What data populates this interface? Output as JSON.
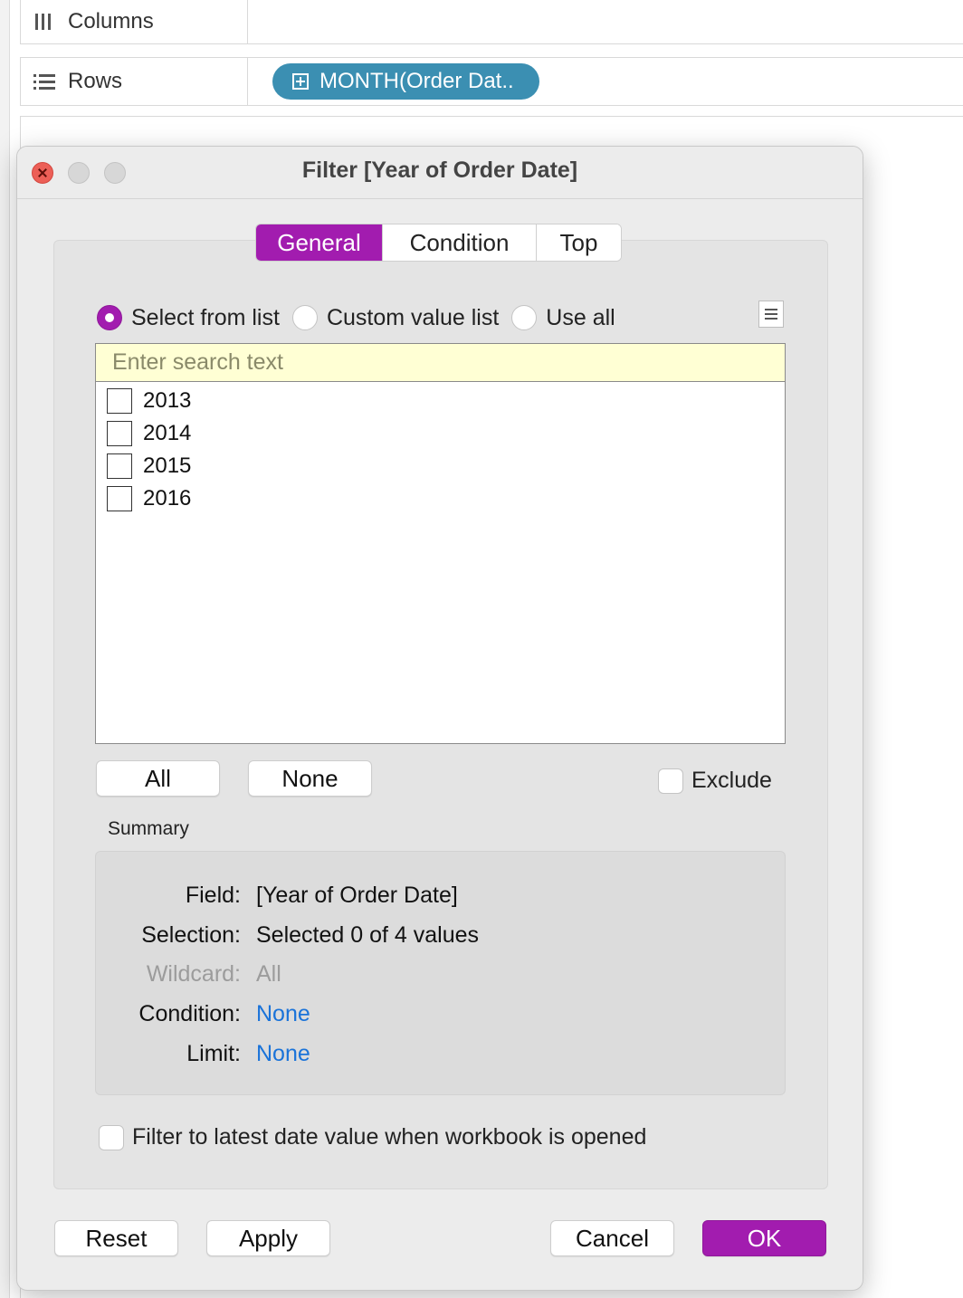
{
  "shelves": {
    "columns_label": "Columns",
    "rows_label": "Rows",
    "rows_pill": "MONTH(Order Dat.."
  },
  "dialog": {
    "title": "Filter [Year of Order Date]",
    "tabs": [
      "General",
      "Condition",
      "Top"
    ],
    "active_tab": "General",
    "mode_options": [
      "Select from list",
      "Custom value list",
      "Use all"
    ],
    "selected_mode": "Select from list",
    "search_placeholder": "Enter search text",
    "values": [
      "2013",
      "2014",
      "2015",
      "2016"
    ],
    "all_button": "All",
    "none_button": "None",
    "exclude_label": "Exclude",
    "exclude_checked": false,
    "summary_title": "Summary",
    "summary": {
      "field_key": "Field:",
      "field_val": "[Year of Order Date]",
      "selection_key": "Selection:",
      "selection_val": "Selected 0 of 4 values",
      "wildcard_key": "Wildcard:",
      "wildcard_val": "All",
      "condition_key": "Condition:",
      "condition_val": "None",
      "limit_key": "Limit:",
      "limit_val": "None"
    },
    "latest_date_label": "Filter to latest date value when workbook is opened",
    "latest_date_checked": false,
    "buttons": {
      "reset": "Reset",
      "apply": "Apply",
      "cancel": "Cancel",
      "ok": "OK"
    }
  },
  "colors": {
    "accent": "#a21caf",
    "pill": "#3b8fb2",
    "link": "#1a73d9",
    "search_bg": "#ffffd4"
  }
}
